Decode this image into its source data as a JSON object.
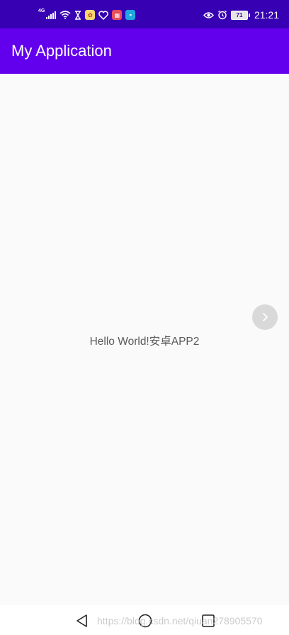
{
  "status_bar": {
    "network_label": "4G",
    "battery_level": "71",
    "time": "21:21",
    "left_icons": [
      "signal-icon",
      "wifi-icon",
      "hourglass-icon",
      "notification-app-icon",
      "heart-app-icon",
      "calendar-app-icon",
      "photo-app-icon"
    ],
    "right_icons": [
      "eye-icon",
      "alarm-icon",
      "battery-icon"
    ]
  },
  "app_bar": {
    "title": "My Application",
    "color": "#6200ee"
  },
  "content": {
    "hello_text": "Hello World!安卓APP2",
    "side_button_icon": "chevron-right-icon"
  },
  "nav_bar": {
    "buttons": [
      "back-icon",
      "home-icon",
      "recents-icon"
    ],
    "watermark": "https://blog.csdn.net/qiuan278905570"
  },
  "colors": {
    "status_bar": "#3700b3",
    "app_bar": "#6200ee",
    "background": "#fafafa"
  }
}
